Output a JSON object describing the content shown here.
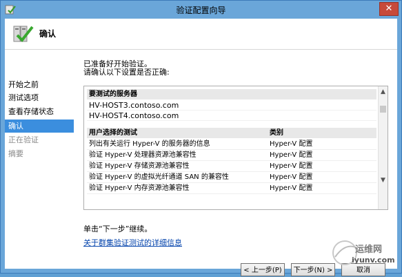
{
  "window": {
    "title": "验证配置向导",
    "close_glyph": "✕"
  },
  "header": {
    "title": "确认",
    "icon": "wizard-check-icon"
  },
  "steps": [
    {
      "label": "开始之前",
      "state": "normal"
    },
    {
      "label": "测试选项",
      "state": "normal"
    },
    {
      "label": "查看存储状态",
      "state": "normal"
    },
    {
      "label": "确认",
      "state": "active"
    },
    {
      "label": "正在验证",
      "state": "disabled"
    },
    {
      "label": "摘要",
      "state": "disabled"
    }
  ],
  "main": {
    "intro_line1": "已准备好开始验证。",
    "intro_line2": "请确认以下设置是否正确:",
    "servers_header": "要测试的服务器",
    "servers": [
      "HV-HOST3.contoso.com",
      "HV-HOST4.contoso.com"
    ],
    "tests_header": {
      "name": "用户选择的测试",
      "category": "类别"
    },
    "tests": [
      {
        "name": "列出有关运行 Hyper-V 的服务器的信息",
        "category": "Hyper-V 配置"
      },
      {
        "name": "验证 Hyper-V 处理器资源池兼容性",
        "category": "Hyper-V 配置"
      },
      {
        "name": "验证 Hyper-V 存储资源池兼容性",
        "category": "Hyper-V 配置"
      },
      {
        "name": "验证 Hyper-V 的虚拟光纤通道 SAN 的兼容性",
        "category": "Hyper-V 配置"
      },
      {
        "name": "验证 Hyper-V 内存资源池兼容性",
        "category": "Hyper-V 配置"
      }
    ],
    "next_hint": "单击“下一步”继续。",
    "details_link": "关于群集验证测试的详细信息"
  },
  "buttons": {
    "back": "< 上一步(P)",
    "next": "下一步(N) >",
    "cancel": "取消"
  },
  "watermark": {
    "site_name": "运维网",
    "url": "iyunv.com"
  },
  "colors": {
    "titlebar": "#6aa6d9",
    "selection": "#3b8ede",
    "close": "#c74a3a",
    "link": "#0645ad"
  }
}
